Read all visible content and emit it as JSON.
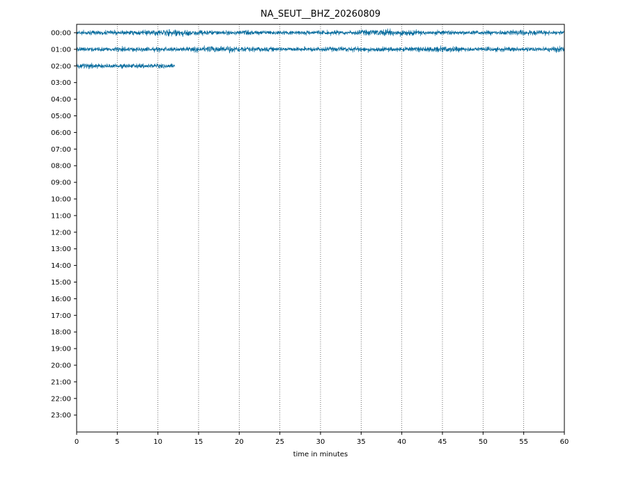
{
  "chart_data": {
    "type": "line",
    "title": "NA_SEUT__BHZ_20260809",
    "xlabel": "time in minutes",
    "ylabel": "",
    "xlim": [
      0,
      60
    ],
    "x_ticks": [
      0,
      5,
      10,
      15,
      20,
      25,
      30,
      35,
      40,
      45,
      50,
      55,
      60
    ],
    "y_tick_labels": [
      "00:00",
      "01:00",
      "02:00",
      "03:00",
      "04:00",
      "05:00",
      "06:00",
      "07:00",
      "08:00",
      "09:00",
      "10:00",
      "11:00",
      "12:00",
      "13:00",
      "14:00",
      "15:00",
      "16:00",
      "17:00",
      "18:00",
      "19:00",
      "20:00",
      "21:00",
      "22:00",
      "23:00"
    ],
    "grid": "vertical dotted lines at x ticks",
    "series": [
      {
        "hour": "00:00",
        "x_start": 0,
        "x_end": 60
      },
      {
        "hour": "01:00",
        "x_start": 0,
        "x_end": 60
      },
      {
        "hour": "02:00",
        "x_start": 0,
        "x_end": 12.1
      }
    ],
    "colors": {
      "trace": "#00689b",
      "grid": "#444444",
      "axis": "#000000"
    }
  }
}
